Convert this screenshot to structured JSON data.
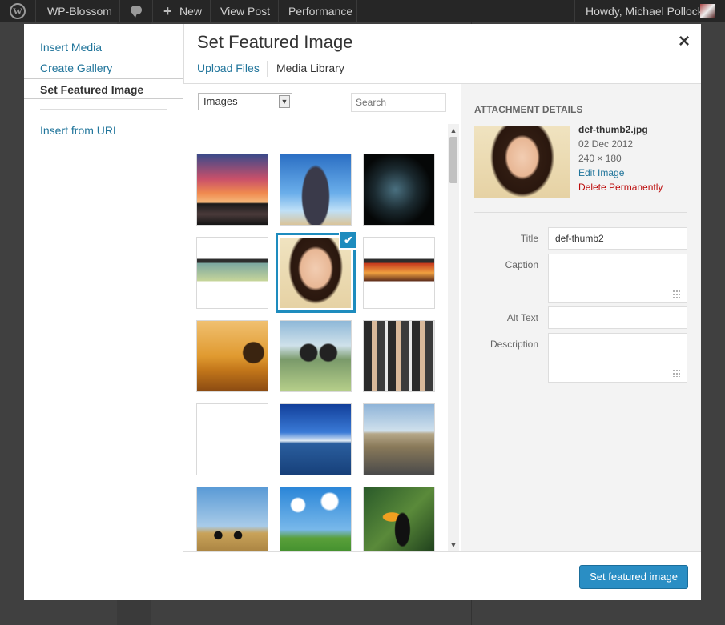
{
  "admin_bar": {
    "site_name": "WP-Blossom",
    "new_label": "New",
    "view_post": "View Post",
    "performance": "Performance",
    "greeting": "Howdy, Michael Pollock"
  },
  "modal": {
    "title": "Set Featured Image",
    "close_symbol": "×",
    "menu": {
      "items": [
        {
          "label": "Insert Media"
        },
        {
          "label": "Create Gallery"
        },
        {
          "label": "Set Featured Image"
        },
        {
          "label": "Insert from URL"
        }
      ],
      "active_index": 2
    },
    "tabs": [
      {
        "label": "Upload Files"
      },
      {
        "label": "Media Library"
      }
    ],
    "filter": {
      "selected": "Images"
    },
    "search": {
      "placeholder": "Search"
    },
    "attachments": [
      {
        "icon": "sunset-lake-thumbnail",
        "selected": false
      },
      {
        "icon": "woman-arms-raised-thumbnail",
        "selected": false
      },
      {
        "icon": "dark-splatter-thumbnail",
        "selected": false
      },
      {
        "icon": "website-screenshot-thumbnail",
        "selected": false
      },
      {
        "icon": "smiling-woman-thumbnail",
        "selected": true
      },
      {
        "icon": "website-screenshot-thumbnail",
        "selected": false
      },
      {
        "icon": "tree-sunset-thumbnail",
        "selected": false
      },
      {
        "icon": "binoculars-thumbnail",
        "selected": false
      },
      {
        "icon": "business-team-thumbnail",
        "selected": false
      },
      {
        "icon": "field-sunset-thumbnail",
        "selected": false
      },
      {
        "icon": "ocean-sky-thumbnail",
        "selected": false
      },
      {
        "icon": "desert-road-thumbnail",
        "selected": false
      },
      {
        "icon": "cyclist-thumbnail",
        "selected": false
      },
      {
        "icon": "grass-sky-thumbnail",
        "selected": false
      },
      {
        "icon": "toucan-thumbnail",
        "selected": false
      }
    ],
    "details": {
      "heading": "ATTACHMENT DETAILS",
      "filename": "def-thumb2.jpg",
      "date": "02 Dec 2012",
      "dimensions": "240 × 180",
      "edit_link": "Edit Image",
      "delete_link": "Delete Permanently",
      "fields": [
        {
          "label": "Title",
          "value": "def-thumb2"
        },
        {
          "label": "Caption",
          "value": ""
        },
        {
          "label": "Alt Text",
          "value": ""
        },
        {
          "label": "Description",
          "value": ""
        }
      ]
    },
    "primary_button": "Set featured image"
  },
  "colors": {
    "link": "#21759b",
    "selected_border": "#1e8cbe",
    "button": "#2a8ec4",
    "delete": "#bc0b0b"
  }
}
